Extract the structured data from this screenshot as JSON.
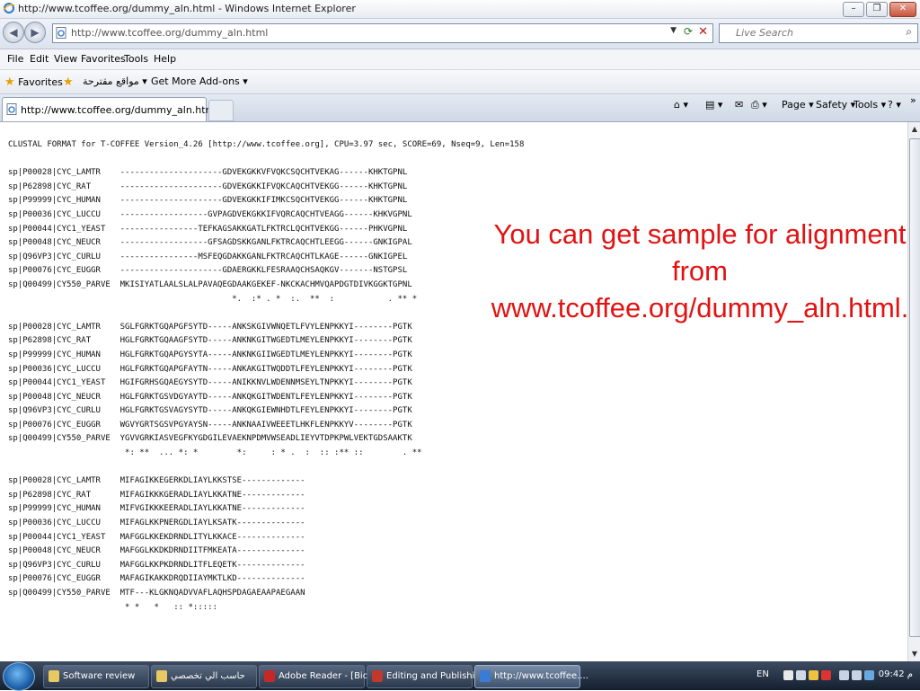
{
  "window": {
    "title": "http://www.tcoffee.org/dummy_aln.html - Windows Internet Explorer",
    "controls": [
      "–",
      "❐",
      "✕"
    ]
  },
  "navigation": {
    "back_glyph": "◀",
    "forward_glyph": "▶",
    "address": "http://www.tcoffee.org/dummy_aln.html",
    "dropdown_glyph": "▼",
    "refresh_glyph": "⟳",
    "stop_glyph": "✕",
    "search_placeholder": "Live Search",
    "search_glyph": "⌕"
  },
  "menu": [
    "File",
    "Edit",
    "View",
    "Favorites",
    "Tools",
    "Help"
  ],
  "favorites_bar": {
    "favorites_label": "Favorites",
    "suggested_sites": "مواقع مقترحة ▾",
    "get_addons": "Get More Add-ons ▾"
  },
  "tabs": [
    {
      "label": "http://www.tcoffee.org/dummy_aln.html"
    }
  ],
  "command_bar": {
    "home": "⌂ ▾",
    "feeds": "▤ ▾",
    "mail": "✉",
    "print": "⎙ ▾",
    "page": "Page ▾",
    "safety": "Safety ▾",
    "tools": "Tools ▾",
    "help": "? ▾",
    "more": "»"
  },
  "page": {
    "alignment_text": "CLUSTAL FORMAT for T-COFFEE Version_4.26 [http://www.tcoffee.org], CPU=3.97 sec, SCORE=69, Nseq=9, Len=158\n\nsp|P00028|CYC_LAMTR    ---------------------GDVEKGKKVFVQKCSQCHTVEKAG------KHKTGPNL\nsp|P62898|CYC_RAT      ---------------------GDVEKGKKIFVQKCAQCHTVEKGG------KHKTGPNL\nsp|P99999|CYC_HUMAN    ---------------------GDVEKGKKIFIMKCSQCHTVEKGG------KHKTGPNL\nsp|P00036|CYC_LUCCU    ------------------GVPAGDVEKGKKIFVQRCAQCHTVEAGG------KHKVGPNL\nsp|P00044|CYC1_YEAST   ----------------TEFKAGSAKKGATLFKTRCLQCHTVEKGG------PHKVGPNL\nsp|P00048|CYC_NEUCR    ------------------GFSAGDSKKGANLFKTRCAQCHTLEEGG------GNKIGPAL\nsp|Q96VP3|CYC_CURLU    ----------------MSFEQGDAKKGANLFKTRCAQCHTLKAGE------GNKIGPEL\nsp|P00076|CYC_EUGGR    ---------------------GDAERGKKLFESRAAQCHSAQKGV-------NSTGPSL\nsp|Q00499|CY550_PARVE  MKISIYATLAALSLALPAVAQEGDAAKGEKEF-NKCKACHMVQAPDGTDIVKGGKTGPNL\n                                              *.  :* . *  :.  **  :           . ** *\n\nsp|P00028|CYC_LAMTR    SGLFGRKTGQAPGFSYTD-----ANKSKGIVWNQETLFVYLENPKKYI--------PGTK\nsp|P62898|CYC_RAT      HGLFGRKTGQAAGFSYTD-----ANKNKGITWGEDTLMEYLENPKKYI--------PGTK\nsp|P99999|CYC_HUMAN    HGLFGRKTGQAPGYSYTA-----ANKNKGIIWGEDTLMEYLENPKKYI--------PGTK\nsp|P00036|CYC_LUCCU    HGLFGRKTGQAPGFAYTN-----ANKAKGITWQDDTLFEYLENPKKYI--------PGTK\nsp|P00044|CYC1_YEAST   HGIFGRHSGQAEGYSYTD-----ANIKKNVLWDENNMSEYLTNPKKYI--------PGTK\nsp|P00048|CYC_NEUCR    HGLFGRKTGSVDGYAYTD-----ANKQKGITWDENTLFEYLENPKKYI--------PGTK\nsp|Q96VP3|CYC_CURLU    HGLFGRKTGSVAGYSYTD-----ANKQKGIEWNHDTLFEYLENPKKYI--------PGTK\nsp|P00076|CYC_EUGGR    WGVYGRTSGSVPGYAYSN-----ANKNAAIVWEEETLHKFLENPKKYV--------PGTK\nsp|Q00499|CY550_PARVE  YGVVGRKIASVEGFKYGDGILEVAEKNPDMVWSEADLIEYVTDPKPWLVEKTGDSAAKTK\n                        *: **  ... *: *        *:     : * .  :  :: :** ::        . **\n\nsp|P00028|CYC_LAMTR    MIFAGIKKEGERKDLIAYLKKSTSE-------------\nsp|P62898|CYC_RAT      MIFAGIKKKGERADLIAYLKKATNE-------------\nsp|P99999|CYC_HUMAN    MIFVGIKKKEERADLIAYLKKATNE-------------\nsp|P00036|CYC_LUCCU    MIFAGLKKPNERGDLIAYLKSATK--------------\nsp|P00044|CYC1_YEAST   MAFGGLKKEKDRNDLITYLKKACE--------------\nsp|P00048|CYC_NEUCR    MAFGGLKKDKDRNDIITFMKEATA--------------\nsp|Q96VP3|CYC_CURLU    MAFGGLKKPKDRNDLITFLEQETK--------------\nsp|P00076|CYC_EUGGR    MAFAGIKAKKDRQDIIAYMKTLKD--------------\nsp|Q00499|CY550_PARVE  MTF---KLGKNQADVVAFLAQHSPDAGAEAAPAEGAAN\n                        * *   *   :: *:::::",
    "note": "You  can get sample for alignment from www.tcoffee.org/dummy_aln.html."
  },
  "taskbar": {
    "tasks": [
      {
        "label": "Software review",
        "color": "#e8c860"
      },
      {
        "label": "حاسب الي تخصصي",
        "color": "#e8c860"
      },
      {
        "label": "Adobe Reader - [Bio...",
        "color": "#c62828"
      },
      {
        "label": "Editing and Publishi...",
        "color": "#c0392b"
      },
      {
        "label": "http://www.tcoffee....",
        "color": "#3a7bd5"
      }
    ],
    "language": "EN",
    "clock": "09:42 م"
  },
  "colors": {
    "note_red": "#e21212",
    "taskbar": "#1b2a3c",
    "chrome": "#dbe3ee"
  }
}
